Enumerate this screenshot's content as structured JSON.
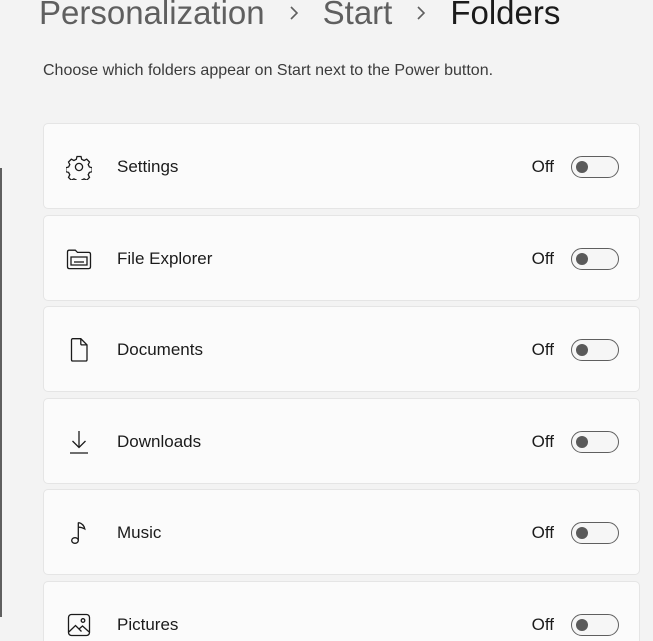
{
  "breadcrumb": {
    "items": [
      "Personalization",
      "Start",
      "Folders"
    ]
  },
  "description": "Choose which folders appear on Start next to the Power button.",
  "folders": [
    {
      "label": "Settings",
      "state": "Off",
      "icon": "gear-icon",
      "on": false
    },
    {
      "label": "File Explorer",
      "state": "Off",
      "icon": "folder-icon",
      "on": false
    },
    {
      "label": "Documents",
      "state": "Off",
      "icon": "document-icon",
      "on": false
    },
    {
      "label": "Downloads",
      "state": "Off",
      "icon": "download-icon",
      "on": false
    },
    {
      "label": "Music",
      "state": "Off",
      "icon": "music-note-icon",
      "on": false
    },
    {
      "label": "Pictures",
      "state": "Off",
      "icon": "picture-icon",
      "on": false
    }
  ],
  "colors": {
    "background": "#f3f3f3",
    "card": "#fbfbfb",
    "card_border": "#e5e5e5",
    "toggle_off": "#5a5a5a",
    "text": "#1b1b1b",
    "muted_text": "#5f5f5f"
  }
}
